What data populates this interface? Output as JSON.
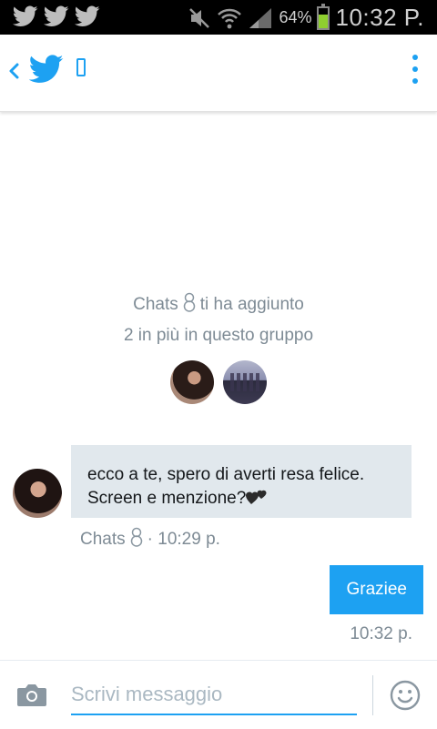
{
  "status_bar": {
    "battery_percent": "64%",
    "battery_level": 0.64,
    "time": "10:32 P.",
    "icons": [
      "twitter-bird-icon",
      "twitter-bird-icon",
      "twitter-bird-icon",
      "mute-icon",
      "wifi-icon",
      "signal-icon",
      "battery-icon"
    ]
  },
  "action_bar": {
    "icons": [
      "back-chevron-icon",
      "twitter-logo-icon",
      "unknown-glyph-icon",
      "overflow-menu-icon"
    ]
  },
  "conversation": {
    "system": {
      "line1_name": "Chats",
      "line1_rest": "ti ha aggiunto",
      "line2": "2 in più in questo gruppo"
    },
    "messages": [
      {
        "direction": "incoming",
        "line1": "ecco a te, spero di averti resa felice.",
        "line2": "Screen e menzione?",
        "sender": "Chats",
        "time": "· 10:29 p."
      },
      {
        "direction": "outgoing",
        "text": "Graziee",
        "time": "10:32 p."
      }
    ]
  },
  "compose": {
    "placeholder": "Scrivi messaggio",
    "icons": [
      "camera-icon",
      "emoji-icon"
    ]
  },
  "colors": {
    "accent": "#1da1f2",
    "incoming_bubble": "#e1e8ed",
    "muted_text": "#7e8b95",
    "status_bar": "#000000",
    "battery_fill": "#8fcf2f"
  }
}
